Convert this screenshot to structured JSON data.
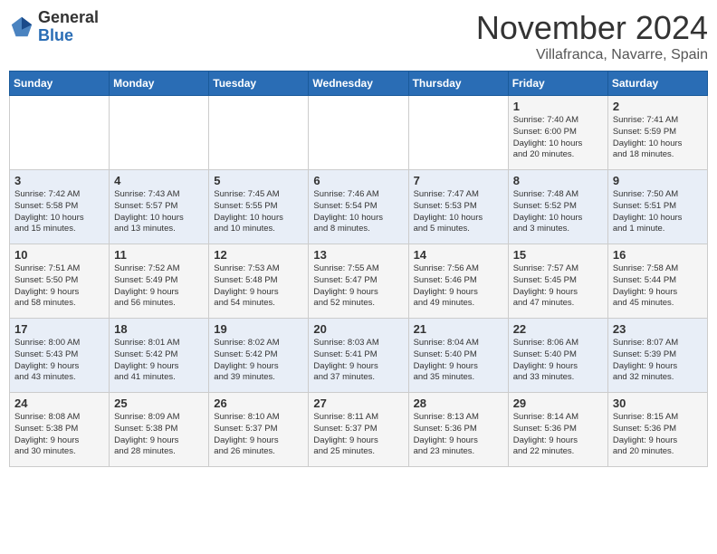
{
  "logo": {
    "general": "General",
    "blue": "Blue"
  },
  "title": "November 2024",
  "location": "Villafranca, Navarre, Spain",
  "days_of_week": [
    "Sunday",
    "Monday",
    "Tuesday",
    "Wednesday",
    "Thursday",
    "Friday",
    "Saturday"
  ],
  "weeks": [
    [
      {
        "day": "",
        "info": ""
      },
      {
        "day": "",
        "info": ""
      },
      {
        "day": "",
        "info": ""
      },
      {
        "day": "",
        "info": ""
      },
      {
        "day": "",
        "info": ""
      },
      {
        "day": "1",
        "info": "Sunrise: 7:40 AM\nSunset: 6:00 PM\nDaylight: 10 hours\nand 20 minutes."
      },
      {
        "day": "2",
        "info": "Sunrise: 7:41 AM\nSunset: 5:59 PM\nDaylight: 10 hours\nand 18 minutes."
      }
    ],
    [
      {
        "day": "3",
        "info": "Sunrise: 7:42 AM\nSunset: 5:58 PM\nDaylight: 10 hours\nand 15 minutes."
      },
      {
        "day": "4",
        "info": "Sunrise: 7:43 AM\nSunset: 5:57 PM\nDaylight: 10 hours\nand 13 minutes."
      },
      {
        "day": "5",
        "info": "Sunrise: 7:45 AM\nSunset: 5:55 PM\nDaylight: 10 hours\nand 10 minutes."
      },
      {
        "day": "6",
        "info": "Sunrise: 7:46 AM\nSunset: 5:54 PM\nDaylight: 10 hours\nand 8 minutes."
      },
      {
        "day": "7",
        "info": "Sunrise: 7:47 AM\nSunset: 5:53 PM\nDaylight: 10 hours\nand 5 minutes."
      },
      {
        "day": "8",
        "info": "Sunrise: 7:48 AM\nSunset: 5:52 PM\nDaylight: 10 hours\nand 3 minutes."
      },
      {
        "day": "9",
        "info": "Sunrise: 7:50 AM\nSunset: 5:51 PM\nDaylight: 10 hours\nand 1 minute."
      }
    ],
    [
      {
        "day": "10",
        "info": "Sunrise: 7:51 AM\nSunset: 5:50 PM\nDaylight: 9 hours\nand 58 minutes."
      },
      {
        "day": "11",
        "info": "Sunrise: 7:52 AM\nSunset: 5:49 PM\nDaylight: 9 hours\nand 56 minutes."
      },
      {
        "day": "12",
        "info": "Sunrise: 7:53 AM\nSunset: 5:48 PM\nDaylight: 9 hours\nand 54 minutes."
      },
      {
        "day": "13",
        "info": "Sunrise: 7:55 AM\nSunset: 5:47 PM\nDaylight: 9 hours\nand 52 minutes."
      },
      {
        "day": "14",
        "info": "Sunrise: 7:56 AM\nSunset: 5:46 PM\nDaylight: 9 hours\nand 49 minutes."
      },
      {
        "day": "15",
        "info": "Sunrise: 7:57 AM\nSunset: 5:45 PM\nDaylight: 9 hours\nand 47 minutes."
      },
      {
        "day": "16",
        "info": "Sunrise: 7:58 AM\nSunset: 5:44 PM\nDaylight: 9 hours\nand 45 minutes."
      }
    ],
    [
      {
        "day": "17",
        "info": "Sunrise: 8:00 AM\nSunset: 5:43 PM\nDaylight: 9 hours\nand 43 minutes."
      },
      {
        "day": "18",
        "info": "Sunrise: 8:01 AM\nSunset: 5:42 PM\nDaylight: 9 hours\nand 41 minutes."
      },
      {
        "day": "19",
        "info": "Sunrise: 8:02 AM\nSunset: 5:42 PM\nDaylight: 9 hours\nand 39 minutes."
      },
      {
        "day": "20",
        "info": "Sunrise: 8:03 AM\nSunset: 5:41 PM\nDaylight: 9 hours\nand 37 minutes."
      },
      {
        "day": "21",
        "info": "Sunrise: 8:04 AM\nSunset: 5:40 PM\nDaylight: 9 hours\nand 35 minutes."
      },
      {
        "day": "22",
        "info": "Sunrise: 8:06 AM\nSunset: 5:40 PM\nDaylight: 9 hours\nand 33 minutes."
      },
      {
        "day": "23",
        "info": "Sunrise: 8:07 AM\nSunset: 5:39 PM\nDaylight: 9 hours\nand 32 minutes."
      }
    ],
    [
      {
        "day": "24",
        "info": "Sunrise: 8:08 AM\nSunset: 5:38 PM\nDaylight: 9 hours\nand 30 minutes."
      },
      {
        "day": "25",
        "info": "Sunrise: 8:09 AM\nSunset: 5:38 PM\nDaylight: 9 hours\nand 28 minutes."
      },
      {
        "day": "26",
        "info": "Sunrise: 8:10 AM\nSunset: 5:37 PM\nDaylight: 9 hours\nand 26 minutes."
      },
      {
        "day": "27",
        "info": "Sunrise: 8:11 AM\nSunset: 5:37 PM\nDaylight: 9 hours\nand 25 minutes."
      },
      {
        "day": "28",
        "info": "Sunrise: 8:13 AM\nSunset: 5:36 PM\nDaylight: 9 hours\nand 23 minutes."
      },
      {
        "day": "29",
        "info": "Sunrise: 8:14 AM\nSunset: 5:36 PM\nDaylight: 9 hours\nand 22 minutes."
      },
      {
        "day": "30",
        "info": "Sunrise: 8:15 AM\nSunset: 5:36 PM\nDaylight: 9 hours\nand 20 minutes."
      }
    ]
  ]
}
